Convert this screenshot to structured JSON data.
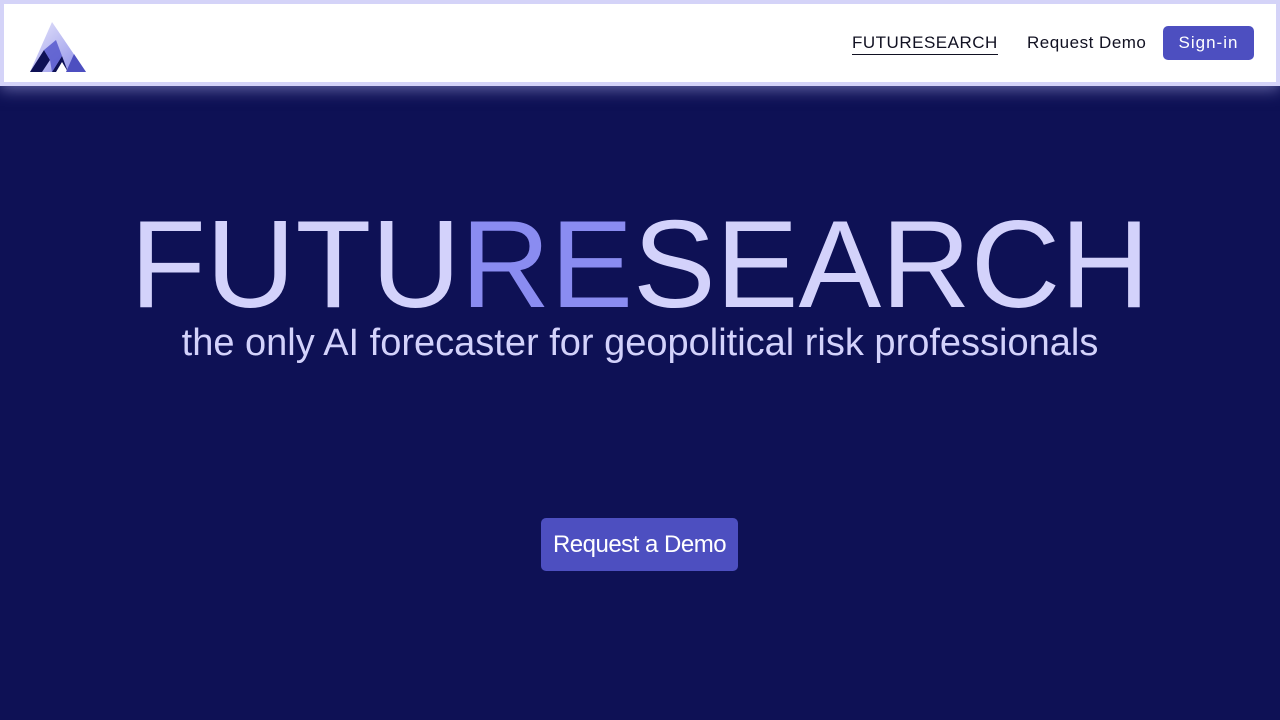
{
  "header": {
    "logo_icon": "triangle-logo-icon",
    "nav": {
      "futuresearch_label": "FUTURESEARCH",
      "request_demo_label": "Request Demo"
    },
    "signin_label": "Sign-in"
  },
  "hero": {
    "title_part1": "FUTU",
    "title_highlight": "RE",
    "title_part2": "SEARCH",
    "subtitle": "the only AI forecaster for geopolitical risk professionals",
    "cta_label": "Request a Demo"
  },
  "colors": {
    "background": "#0e1155",
    "title": "#d3d2fb",
    "title_highlight": "#8a8cf1",
    "button": "#4d4fc0",
    "header_border": "#d4d3f8"
  }
}
